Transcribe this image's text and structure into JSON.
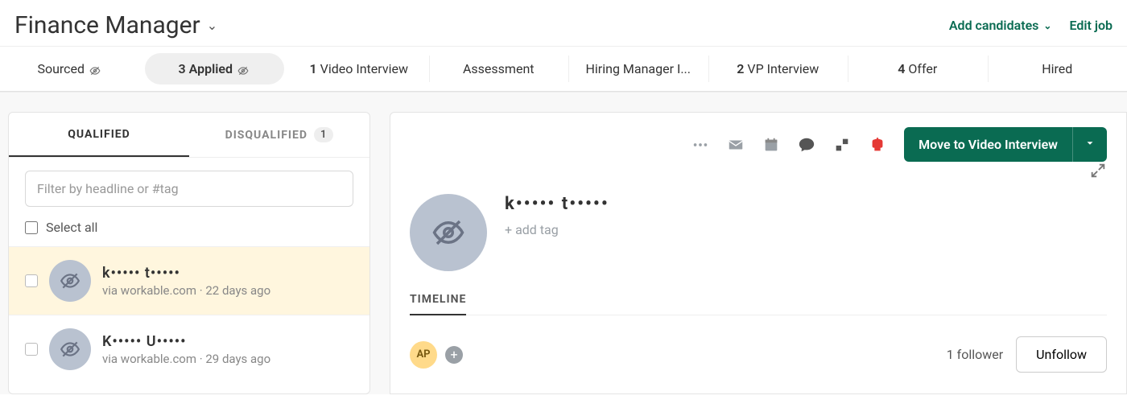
{
  "header": {
    "job_title": "Finance Manager",
    "add_candidates_label": "Add candidates",
    "edit_job_label": "Edit job"
  },
  "stages": [
    {
      "count": "",
      "label": "Sourced",
      "show_eye_off": true,
      "active": false
    },
    {
      "count": "3",
      "label": "Applied",
      "show_eye_off": true,
      "active": true
    },
    {
      "count": "1",
      "label": "Video Interview",
      "show_eye_off": false,
      "active": false
    },
    {
      "count": "",
      "label": "Assessment",
      "show_eye_off": false,
      "active": false
    },
    {
      "count": "",
      "label": "Hiring Manager I...",
      "show_eye_off": false,
      "active": false
    },
    {
      "count": "2",
      "label": "VP Interview",
      "show_eye_off": false,
      "active": false
    },
    {
      "count": "4",
      "label": "Offer",
      "show_eye_off": false,
      "active": false
    },
    {
      "count": "",
      "label": "Hired",
      "show_eye_off": false,
      "active": false
    }
  ],
  "sidebar": {
    "tabs": {
      "qualified_label": "QUALIFIED",
      "disqualified_label": "DISQUALIFIED",
      "disqualified_count": "1"
    },
    "filter_placeholder": "Filter by headline or #tag",
    "select_all_label": "Select all",
    "candidates": [
      {
        "name": "k••••• t•••••",
        "sub": "via workable.com · 22 days ago",
        "selected": true
      },
      {
        "name": "K••••• U•••••",
        "sub": "via workable.com · 29 days ago",
        "selected": false
      }
    ]
  },
  "main": {
    "move_button_label": "Move to Video Interview",
    "profile_name": "k••••• t•••••",
    "add_tag_label": "add tag",
    "timeline_label": "TIMELINE",
    "follower_avatar_initials": "AP",
    "follower_text": "1 follower",
    "unfollow_label": "Unfollow"
  }
}
